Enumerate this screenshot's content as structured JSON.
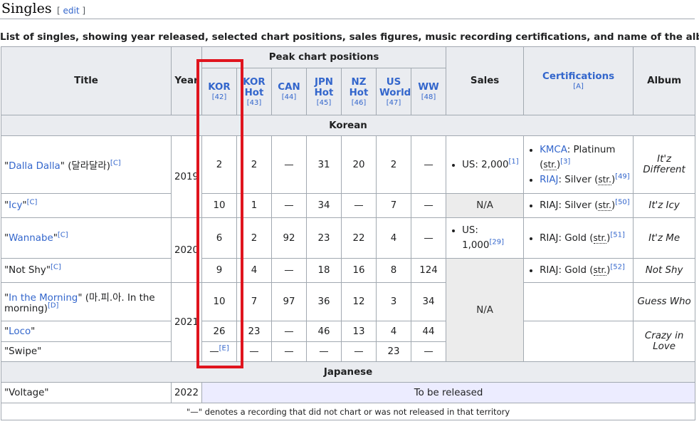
{
  "section": {
    "title": "Singles",
    "edit_label": "edit"
  },
  "caption": "List of singles, showing year released, selected chart positions, sales figures, music recording certifications, and name of the album",
  "headers": {
    "title": "Title",
    "year": "Year",
    "peak": "Peak chart positions",
    "sales": "Sales",
    "certifications": "Certifications",
    "certifications_ref": "[A]",
    "album": "Album",
    "charts": [
      {
        "label": "KOR",
        "ref": "[42]",
        "link": true
      },
      {
        "label": "KOR Hot",
        "ref": "[43]",
        "link": true
      },
      {
        "label": "CAN",
        "ref": "[44]",
        "link": true
      },
      {
        "label": "JPN Hot",
        "ref": "[45]",
        "link": true
      },
      {
        "label": "NZ Hot",
        "ref": "[46]",
        "link": true
      },
      {
        "label": "US World",
        "ref": "[47]",
        "link": true
      },
      {
        "label": "WW",
        "ref": "[48]",
        "link": true
      }
    ]
  },
  "groups": {
    "korean": "Korean",
    "japanese": "Japanese"
  },
  "rows": {
    "dalla": {
      "title_link": "Dalla Dalla",
      "title_rest": " (달라달라)",
      "ref": "[C]",
      "year": "2019",
      "peaks": [
        "2",
        "2",
        "—",
        "31",
        "20",
        "2",
        "—"
      ],
      "sales_text": "US: 2,000",
      "sales_ref": "[1]",
      "cert1_link": "KMCA",
      "cert1_text": ": Platinum (",
      "cert1_abbr": "str.",
      "cert1_close": ")",
      "cert1_ref": "[3]",
      "cert2_link": "RIAJ",
      "cert2_text": ": Silver (",
      "cert2_abbr": "str.",
      "cert2_close": ")",
      "cert2_ref": "[49]",
      "album": "It'z Different"
    },
    "icy": {
      "title_link": "Icy",
      "ref": "[C]",
      "peaks": [
        "10",
        "1",
        "—",
        "34",
        "—",
        "7",
        "—"
      ],
      "sales": "N/A",
      "cert_text": "RIAJ: Silver (",
      "cert_abbr": "str.",
      "cert_close": ")",
      "cert_ref": "[50]",
      "album": "It'z Icy"
    },
    "wannabe": {
      "title_link": "Wannabe",
      "ref": "[C]",
      "year": "2020",
      "peaks": [
        "6",
        "2",
        "92",
        "23",
        "22",
        "4",
        "—"
      ],
      "sales_text": "US: 1,000",
      "sales_ref": "[29]",
      "cert_text": "RIAJ: Gold (",
      "cert_abbr": "str.",
      "cert_close": ")",
      "cert_ref": "[51]",
      "album": "It'z Me"
    },
    "notshy": {
      "title": "Not Shy",
      "ref": "[C]",
      "peaks": [
        "9",
        "4",
        "—",
        "18",
        "16",
        "8",
        "124"
      ],
      "sales": "N/A",
      "cert_text": "RIAJ: Gold (",
      "cert_abbr": "str.",
      "cert_close": ")",
      "cert_ref": "[52]",
      "album": "Not Shy"
    },
    "morning": {
      "title_link": "In the Morning",
      "title_rest": " (마.피.아. In the morning)",
      "ref": "[D]",
      "year": "2021",
      "peaks": [
        "10",
        "7",
        "97",
        "36",
        "12",
        "3",
        "34"
      ],
      "album": "Guess Who"
    },
    "loco": {
      "title_link": "Loco",
      "peaks": [
        "26",
        "23",
        "—",
        "46",
        "13",
        "4",
        "44"
      ],
      "album": "Crazy in Love"
    },
    "swipe": {
      "title": "Swipe",
      "peak_kor": "—",
      "peak_kor_ref": "[E]",
      "peaks": [
        "—",
        "—",
        "—",
        "—",
        "23",
        "—"
      ]
    },
    "voltage": {
      "title": "Voltage",
      "year": "2022",
      "status": "To be released"
    }
  },
  "footnote": "\"—\" denotes a recording that did not chart or was not released in that territory",
  "colors": {
    "header_bg": "#eaecf0",
    "na_bg": "#ececec",
    "tbr_bg": "#ececff",
    "link": "#3366cc",
    "highlight_box": "#e0141e"
  }
}
